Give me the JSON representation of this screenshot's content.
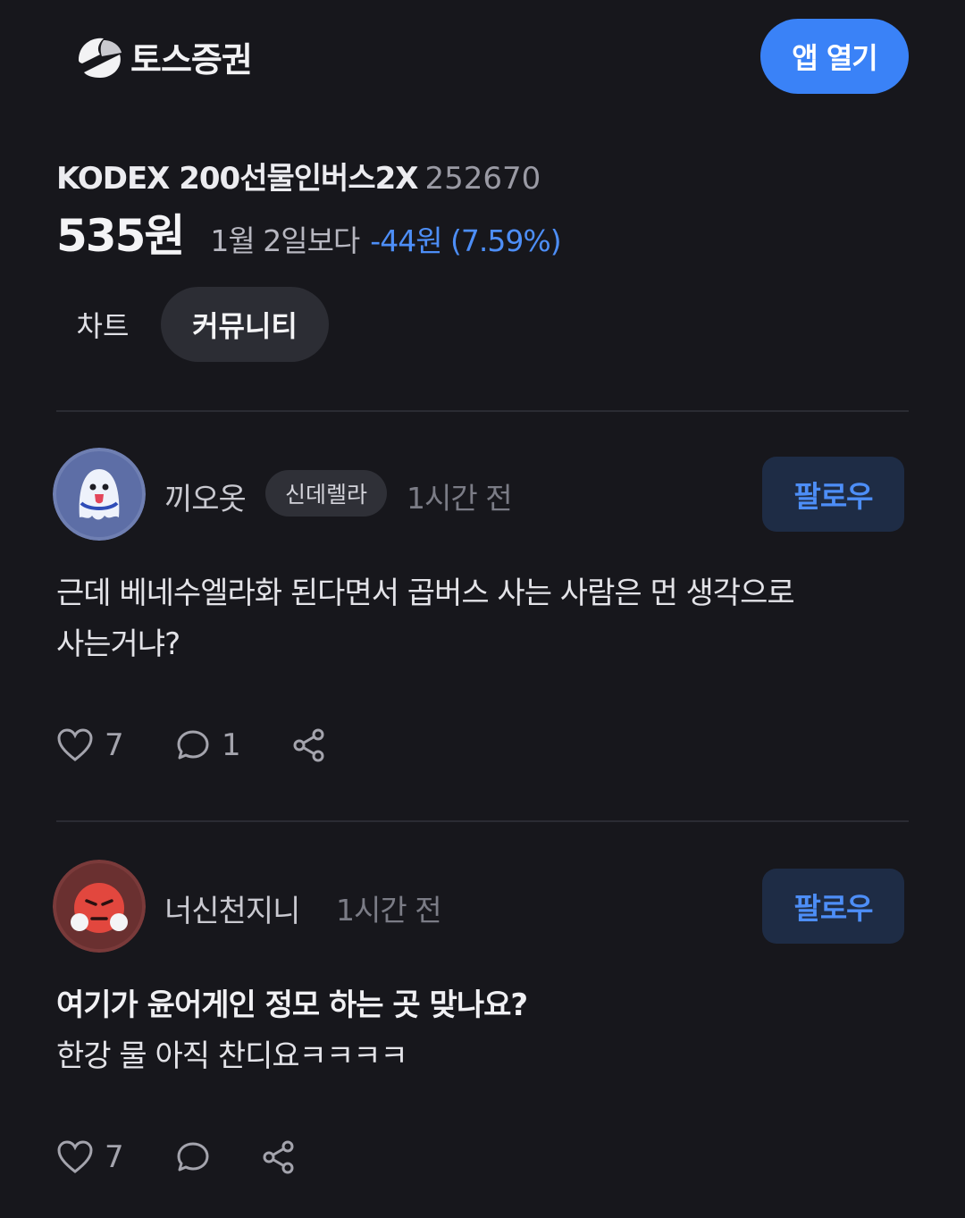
{
  "header": {
    "brand_name": "토스증권",
    "open_app_label": "앱 열기"
  },
  "stock": {
    "name": "KODEX 200선물인버스2X",
    "code": "252670",
    "price": "535원",
    "compare_label": "1월 2일보다",
    "change": "-44원 (7.59%)",
    "change_color": "#4d8ef7"
  },
  "tabs": [
    {
      "label": "차트",
      "active": false
    },
    {
      "label": "커뮤니티",
      "active": true
    }
  ],
  "posts": [
    {
      "author": "끼오옷",
      "badge": "신데렐라",
      "time": "1시간 전",
      "follow_label": "팔로우",
      "lines": [
        "근데 베네수엘라화 된다면서 곱버스 사는 사람은 먼  생각으로",
        "사는거냐?"
      ],
      "likes": "7",
      "comments": "1"
    },
    {
      "author": "너신천지니",
      "time": "1시간 전",
      "follow_label": "팔로우",
      "title": "여기가 윤어게인 정모 하는 곳 맞나요?",
      "lines": [
        "한강 물 아직 찬디요ㅋㅋㅋㅋ"
      ],
      "likes": "7"
    }
  ],
  "colors": {
    "background": "#17171c",
    "accent": "#3a82f7",
    "follow_bg": "#1e2c45"
  }
}
